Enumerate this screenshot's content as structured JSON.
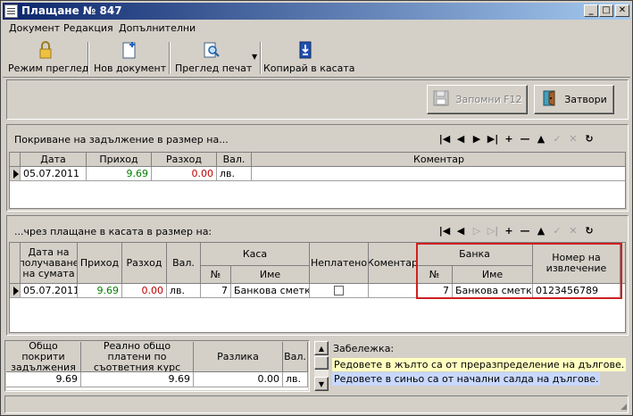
{
  "window": {
    "title": "Плащане № 847",
    "min": "_",
    "max": "□",
    "close": "✕"
  },
  "menu": [
    "Документ",
    "Редакция",
    "Допълнителни"
  ],
  "toolbar": {
    "view_mode": "Режим преглед",
    "new_document": "Нов документ",
    "print_preview": "Преглед печат",
    "copy_to_cash": "Копирай в касата"
  },
  "actions": {
    "save": "Запомни  F12",
    "close": "Затвори"
  },
  "debt": {
    "caption": "Покриване на задължение в размер на...",
    "headers": {
      "date": "Дата",
      "income": "Приход",
      "expense": "Разход",
      "cur": "Вал.",
      "comment": "Коментар"
    },
    "rows": [
      {
        "date": "05.07.2011",
        "income": "9.69",
        "expense": "0.00",
        "cur": "лв.",
        "comment": ""
      }
    ]
  },
  "payment": {
    "caption": "...чрез плащане в касата в размер на:",
    "headers": {
      "date": "Дата на получаване на сумата",
      "income": "Приход",
      "expense": "Разход",
      "cur": "Вал.",
      "cash": "Каса",
      "cash_no": "№",
      "cash_name": "Име",
      "unpaid": "Неплатено",
      "comment": "Коментар",
      "bank": "Банка",
      "bank_no": "№",
      "bank_name": "Име",
      "statement": "Номер на извлечение"
    },
    "rows": [
      {
        "date": "05.07.2011",
        "income": "9.69",
        "expense": "0.00",
        "cur": "лв.",
        "cash_no": "7",
        "cash_name": "Банкова сметка",
        "unpaid": false,
        "comment": "",
        "bank_no": "7",
        "bank_name": "Банкова сметка",
        "statement": "0123456789"
      }
    ]
  },
  "totals": {
    "headers": {
      "covered": "Общо покрити задължения",
      "paid": "Реално общо платени по съответния курс",
      "diff": "Разлика",
      "cur": "Вал."
    },
    "values": {
      "covered": "9.69",
      "paid": "9.69",
      "diff": "0.00",
      "cur": "лв."
    }
  },
  "notes": {
    "label": "Забележка:",
    "yellow": "Редовете в жълто са от преразпределение на дългове.",
    "blue": "Редовете в синьо са от начални салда на дългове."
  },
  "colors": {
    "note_yellow": "#ffffc0",
    "note_blue": "#c8d8ff",
    "highlight": "#d02020",
    "income": "#008000",
    "expense": "#c00000"
  }
}
